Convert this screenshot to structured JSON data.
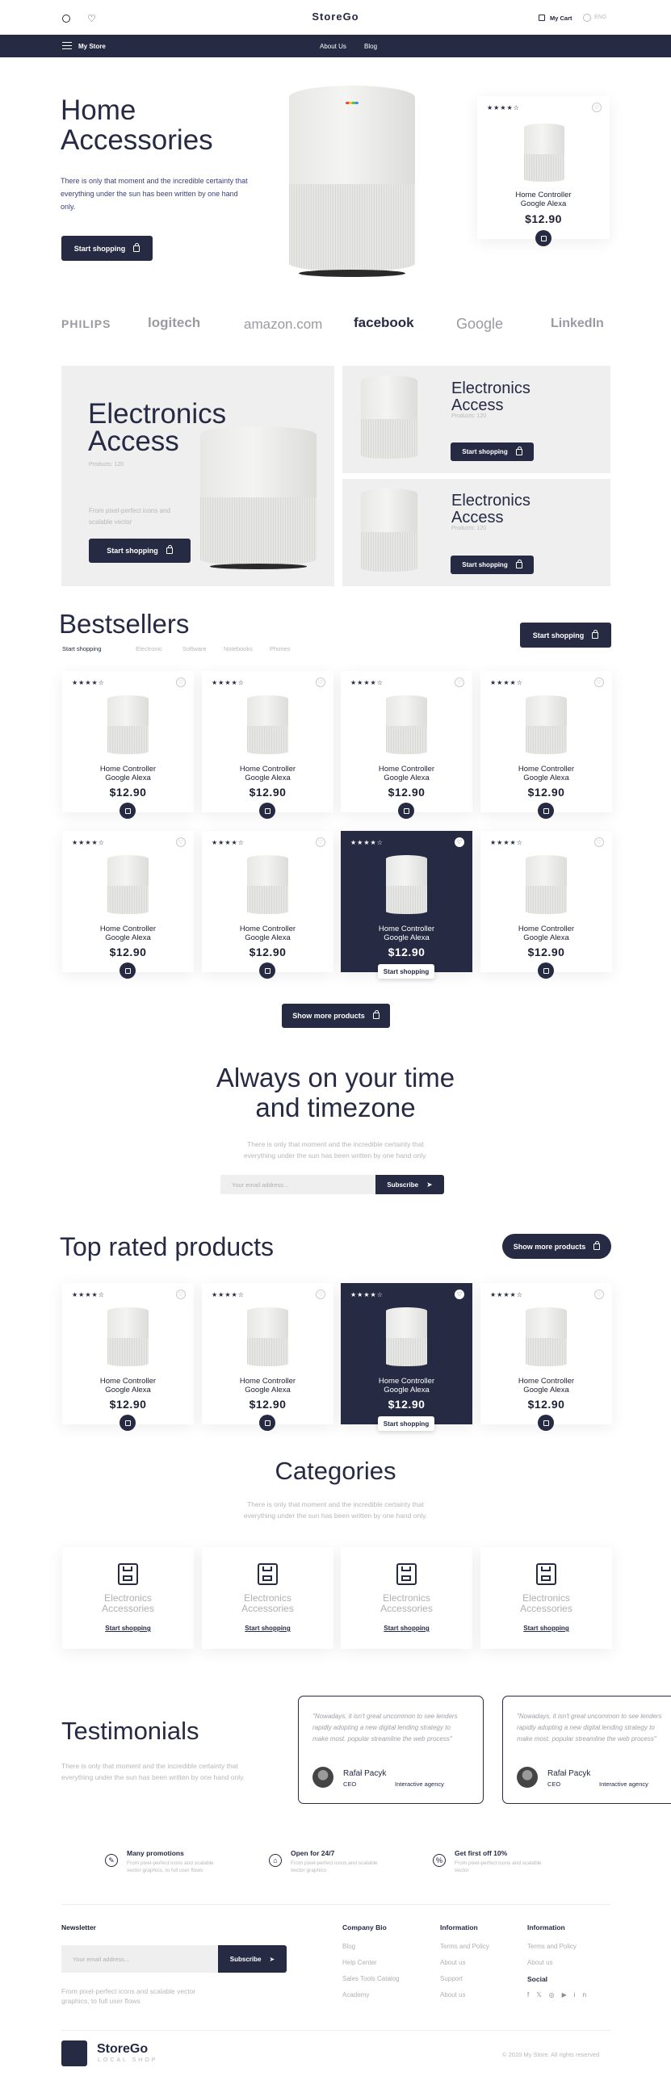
{
  "topbar": {
    "brand": "StoreGo",
    "cart": "My Cart",
    "lang": "ENG"
  },
  "navbar": {
    "store": "My Store",
    "links": [
      "About Us",
      "Blog"
    ]
  },
  "hero": {
    "title_line1": "Home",
    "title_line2": "Accessories",
    "text": "There is only that moment and the incredible certainty that everything under the sun has been written by one hand only.",
    "button": "Start shopping"
  },
  "product": {
    "name_line1": "Home Controller",
    "name_line2": "Google Alexa",
    "price": "$12.90",
    "stars": "★★★★☆",
    "button": "Start shopping"
  },
  "brands": [
    "PHILIPS",
    "logitech",
    "amazon.com",
    "facebook",
    "Google",
    "LinkedIn"
  ],
  "promo": {
    "big_title_line1": "Electronics",
    "big_title_line2": "Access",
    "big_sub": "Products: 120",
    "big_text": "From pixel-perfect icons and scalable vector",
    "button": "Start shopping",
    "small_title_line1": "Electronics",
    "small_title_line2": "Access",
    "small_sub": "Products: 120"
  },
  "bestsellers": {
    "title": "Bestsellers",
    "button": "Start shopping",
    "tabs": [
      "Start shopping",
      "Electronic",
      "Software",
      "Notebooks",
      "Phones"
    ],
    "more": "Show more products"
  },
  "newsletter_hero": {
    "title_line1": "Always on your time",
    "title_line2": "and timezone",
    "text_line1": "There is only that moment and the incredible certainty that",
    "text_line2": "everything under the sun has been written by one hand only.",
    "placeholder": "Your email address...",
    "button": "Subscribe"
  },
  "top_rated": {
    "title": "Top rated products",
    "more": "Show more products"
  },
  "categories": {
    "title": "Categories",
    "text_line1": "There is only that moment and the incredible certainty that",
    "text_line2": "everything under the sun has been written by one hand only.",
    "item_line1": "Electronics",
    "item_line2": "Accessories",
    "link": "Start shopping"
  },
  "testimonials": {
    "title": "Testimonials",
    "text_line1": "There is only that moment and the incredible certainty that",
    "text_line2": "everything under the sun has been written by one hand only.",
    "quote": "\"Nowadays, it isn't great uncommon to see lenders rapidly adopting a new digital lending strategy to make most. popular streamline the web process\"",
    "name": "Rafał Pacyk",
    "role": "CEO",
    "company": "Interactive agency"
  },
  "features": [
    {
      "title": "Many promotions",
      "text": "From pixel-perfect icons and scalable vector graphics, to full user flows"
    },
    {
      "title": "Open for 24/7",
      "text": "From pixel-perfect icons and scalable vector graphics"
    },
    {
      "title": "Get first off 10%",
      "text": "From pixel-perfect icons and scalable vector"
    }
  ],
  "footer": {
    "newsletter": "Newsletter",
    "placeholder": "Your email address...",
    "subscribe": "Subscribe",
    "note": "From pixel-perfect icons and scalable vector graphics, to full user flows",
    "col1": {
      "h": "Company Bio",
      "items": [
        "Blog",
        "Help Center",
        "Sales Tools Catalog",
        "Academy"
      ]
    },
    "col2": {
      "h": "Information",
      "items": [
        "Terms and Policy",
        "About us",
        "Support",
        "About us"
      ]
    },
    "col3": {
      "h": "Information",
      "items": [
        "Terms and Policy",
        "About us"
      ]
    },
    "social": "Social",
    "brand": "StoreGo",
    "tagline": "LOCAL SHOP",
    "copyright": "© 2020 My Store. All rights reserved"
  }
}
